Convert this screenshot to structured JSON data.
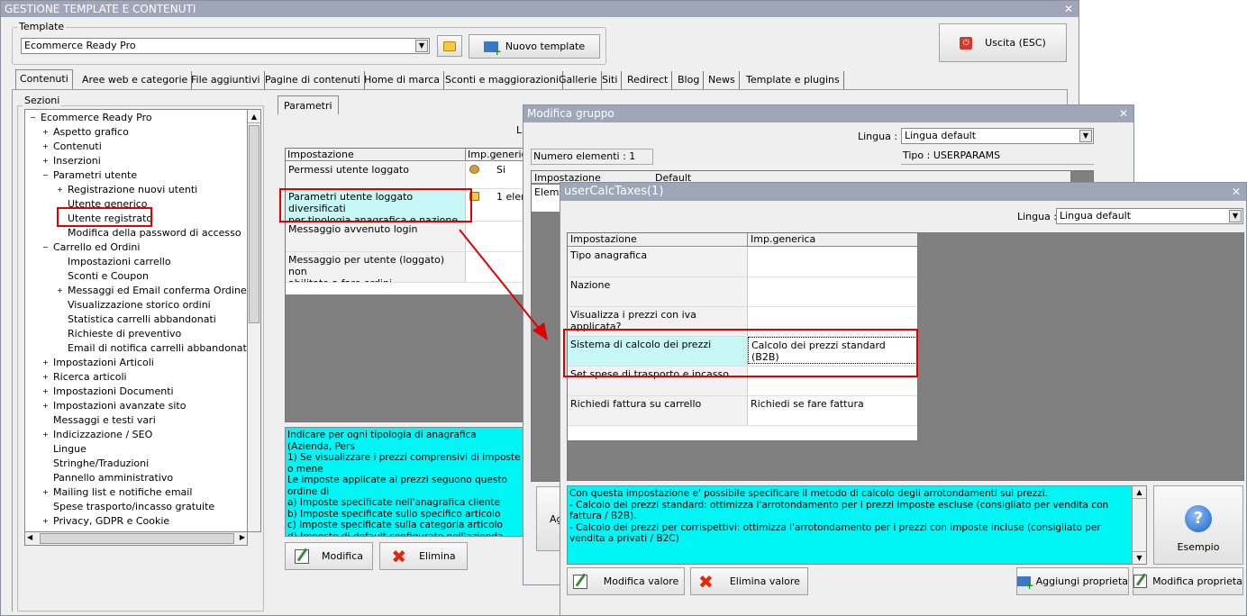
{
  "main_window": {
    "title": "GESTIONE TEMPLATE E CONTENUTI",
    "template_label": "Template",
    "template_value": "Ecommerce Ready Pro",
    "new_template_btn": "Nuovo template",
    "exit_btn": "Uscita (ESC)",
    "tabs": [
      "Contenuti",
      "Aree web e categorie",
      "File aggiuntivi",
      "Pagine di contenuti",
      "Home di marca",
      "Sconti e maggiorazioni",
      "Gallerie",
      "Siti",
      "Redirect",
      "Blog",
      "News",
      "Template e plugins"
    ],
    "sections_label": "Sezioni",
    "tree": [
      {
        "label": "Ecommerce Ready Pro",
        "level": 0,
        "exp": "−"
      },
      {
        "label": "Aspetto grafico",
        "level": 1,
        "exp": "+"
      },
      {
        "label": "Contenuti",
        "level": 1,
        "exp": "+"
      },
      {
        "label": "Inserzioni",
        "level": 1,
        "exp": "+"
      },
      {
        "label": "Parametri utente",
        "level": 1,
        "exp": "−"
      },
      {
        "label": "Registrazione nuovi utenti",
        "level": 2,
        "exp": "+"
      },
      {
        "label": "Utente generico",
        "level": 2,
        "exp": ""
      },
      {
        "label": "Utente registrato",
        "level": 2,
        "exp": ""
      },
      {
        "label": "Modifica della password di accesso",
        "level": 2,
        "exp": ""
      },
      {
        "label": "Carrello ed Ordini",
        "level": 1,
        "exp": "−"
      },
      {
        "label": "Impostazioni carrello",
        "level": 2,
        "exp": ""
      },
      {
        "label": "Sconti e Coupon",
        "level": 2,
        "exp": ""
      },
      {
        "label": "Messaggi ed Email conferma Ordine",
        "level": 2,
        "exp": "+"
      },
      {
        "label": "Visualizzazione storico ordini",
        "level": 2,
        "exp": ""
      },
      {
        "label": "Statistica carrelli abbandonati",
        "level": 2,
        "exp": ""
      },
      {
        "label": "Richieste di preventivo",
        "level": 2,
        "exp": ""
      },
      {
        "label": "Email di notifica carrelli abbandonati",
        "level": 2,
        "exp": ""
      },
      {
        "label": "Impostazioni Articoli",
        "level": 1,
        "exp": "+"
      },
      {
        "label": "Ricerca articoli",
        "level": 1,
        "exp": "+"
      },
      {
        "label": "Impostazioni Documenti",
        "level": 1,
        "exp": "+"
      },
      {
        "label": "Impostazioni avanzate sito",
        "level": 1,
        "exp": "+"
      },
      {
        "label": "Messaggi e testi vari",
        "level": 1,
        "exp": ""
      },
      {
        "label": "Indicizzazione / SEO",
        "level": 1,
        "exp": "+"
      },
      {
        "label": "Lingue",
        "level": 1,
        "exp": ""
      },
      {
        "label": "Stringhe/Traduzioni",
        "level": 1,
        "exp": ""
      },
      {
        "label": "Pannello amministrativo",
        "level": 1,
        "exp": ""
      },
      {
        "label": "Mailing list e notifiche email",
        "level": 1,
        "exp": "+"
      },
      {
        "label": "Spese trasporto/incasso gratuite",
        "level": 1,
        "exp": ""
      },
      {
        "label": "Privacy, GDPR e Cookie",
        "level": 1,
        "exp": "+"
      }
    ],
    "params_tab": "Parametri",
    "li_fragment": "Li",
    "grid_headers": [
      "Impostazione",
      "Imp.generica"
    ],
    "grid_rows": [
      {
        "name": "Permessi utente loggato",
        "value": "Si"
      },
      {
        "name": "Parametri utente loggato diversificati\nper tipologia anagrafica e nazione",
        "value": "1 elem"
      },
      {
        "name": "Messaggio avvenuto login",
        "value": ""
      },
      {
        "name": "Messaggio per utente (loggato) non\nabilitato a fare ordini",
        "value": ""
      }
    ],
    "info_text": "Indicare per ogni tipologia di anagrafica (Azienda, Pers\n1) Se visualizzare i prezzi comprensivi di imposte o mene\nLe imposte applicate ai prezzi seguono questo ordine di\na) Imposte specificate nell'anagrafica cliente\nb) Imposte specificate sullo specifico articolo\nc) Imposte specificate sulla categoria articolo\nd) Imposte di default configurate nell'azienda\nNon specificando un valore sulle varie tipologie di anagra\nsopra esposti.",
    "modify_btn": "Modifica",
    "delete_btn": "Elimina"
  },
  "group_window": {
    "title": "Modifica gruppo",
    "lingua_label": "Lingua :",
    "lingua_value": "Lingua default",
    "count_text": "Numero elementi : 1",
    "tipo_text": "Tipo : USERPARAMS",
    "hdr_imp": "Impostazione",
    "hdr_def": "Default",
    "row_frag": "Eleme",
    "ag_frag": "Ag"
  },
  "calc_window": {
    "title": "userCalcTaxes(1)",
    "lingua_label": "Lingua :",
    "lingua_value": "Lingua default",
    "grid_headers": [
      "Impostazione",
      "Imp.generica"
    ],
    "rows": [
      {
        "name": "Tipo anagrafica",
        "value": ""
      },
      {
        "name": "Nazione",
        "value": ""
      },
      {
        "name": "Visualizza i prezzi con iva applicata?",
        "value": ""
      },
      {
        "name": "Sistema di calcolo dei prezzi",
        "value": "Calcolo dei prezzi standard (B2B)"
      },
      {
        "name": "Set spese di trasporto e incasso",
        "value": ""
      },
      {
        "name": "Richiedi fattura su carrello",
        "value": "Richiedi se fare fattura"
      }
    ],
    "info_text": "Con questa impostazione e' possibile specificare il metodo di calcolo degli arrotondamenti sui prezzi.\n- Calcolo dei prezzi standard: ottimizza l'arrotondamento per i prezzi imposte escluse (consigliato per vendita con fattura / B2B).\n- Calcolo dei prezzi per corrispettivi: ottimizza l'arrotondamento per i prezzi con imposte incluse (consigliato per vendita a privati / B2C)",
    "example_btn": "Esempio",
    "modify_value_btn": "Modifica valore",
    "delete_value_btn": "Elimina valore",
    "add_prop_btn": "Aggiungi proprieta",
    "modify_prop_btn": "Modifica proprieta"
  },
  "colors": {
    "titlebar": "#9fa6b8",
    "highlight": "#00f5f5",
    "annotation": "#e00000",
    "panel_dark": "#808080"
  }
}
